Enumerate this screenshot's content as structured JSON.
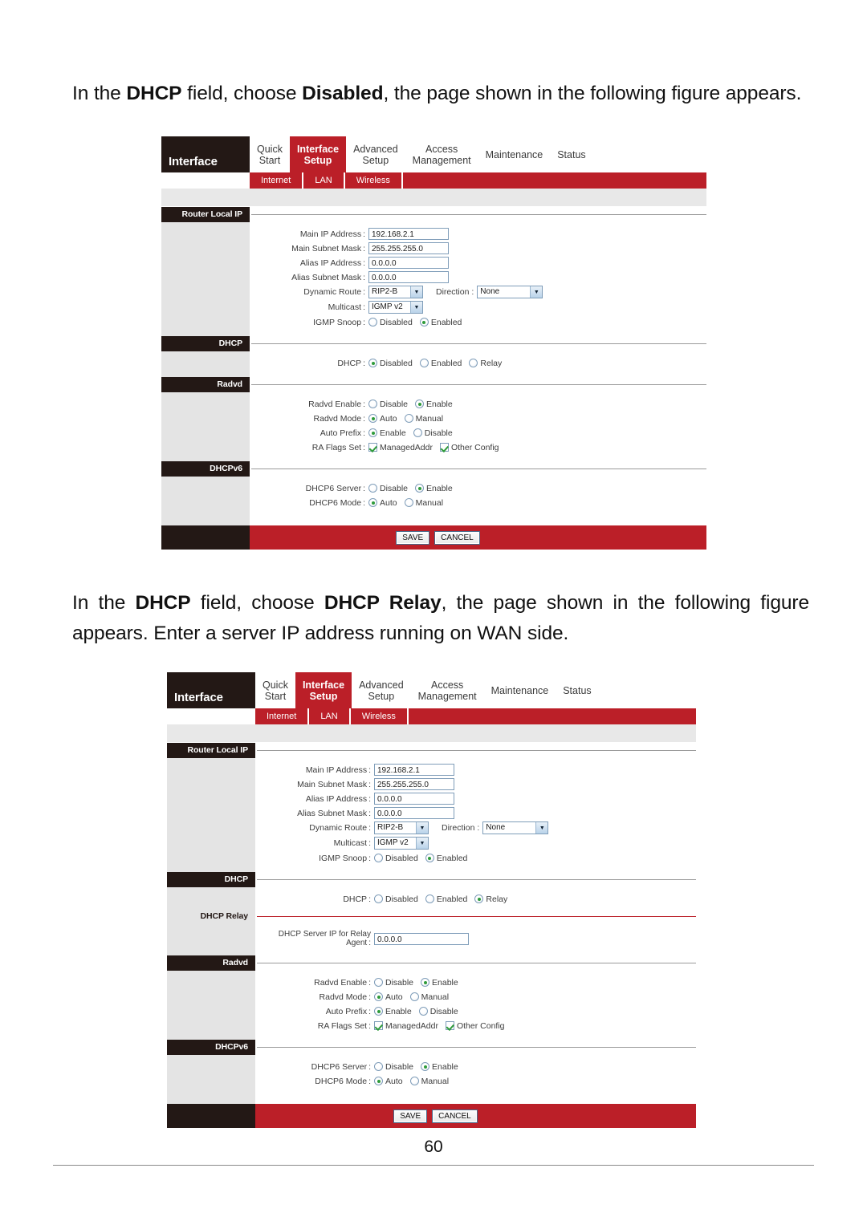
{
  "document": {
    "paragraph_1": {
      "pre": "In the ",
      "bold1": "DHCP",
      "mid": " field, choose ",
      "bold2": "Disabled",
      "post": ", the page shown in the following figure appears."
    },
    "paragraph_2": {
      "pre": "In the ",
      "bold1": "DHCP",
      "mid": " field, choose ",
      "bold2": "DHCP Relay",
      "post": ", the page shown in the following figure appears. Enter a server IP address running on WAN side."
    },
    "page_number": "60"
  },
  "colors": {
    "brand_red": "#bb1f28",
    "dark_bar": "#231815",
    "sidebar_gray": "#e4e4e4",
    "radio_green": "#2e9b3a"
  },
  "router_ui": {
    "brand": "Interface",
    "nav": [
      {
        "line1": "Quick",
        "line2": "Start",
        "active": false
      },
      {
        "line1": "Interface",
        "line2": "Setup",
        "active": true
      },
      {
        "line1": "Advanced",
        "line2": "Setup",
        "active": false
      },
      {
        "line1": "Access",
        "line2": "Management",
        "active": false
      },
      {
        "line1": "Maintenance",
        "line2": "",
        "active": false
      },
      {
        "line1": "Status",
        "line2": "",
        "active": false
      }
    ],
    "subnav": [
      "Internet",
      "LAN",
      "Wireless"
    ],
    "sections": {
      "router_local_ip": "Router Local IP",
      "dhcp": "DHCP",
      "dhcp_relay": "DHCP Relay",
      "radvd": "Radvd",
      "dhcpv6": "DHCPv6"
    },
    "fields": {
      "main_ip_label": "Main IP Address",
      "main_ip_value": "192.168.2.1",
      "main_mask_label": "Main Subnet Mask",
      "main_mask_value": "255.255.255.0",
      "alias_ip_label": "Alias IP Address",
      "alias_ip_value": "0.0.0.0",
      "alias_mask_label": "Alias Subnet Mask",
      "alias_mask_value": "0.0.0.0",
      "dynamic_route_label": "Dynamic Route",
      "dynamic_route_value": "RIP2-B",
      "direction_label": "Direction",
      "direction_value": "None",
      "multicast_label": "Multicast",
      "multicast_value": "IGMP v2",
      "igmp_snoop_label": "IGMP Snoop",
      "igmp_snoop_options": [
        "Disabled",
        "Enabled"
      ],
      "igmp_snoop_selected": "Enabled",
      "dhcp_label": "DHCP",
      "dhcp_options": [
        "Disabled",
        "Enabled",
        "Relay"
      ],
      "dhcp_selected_panel1": "Disabled",
      "dhcp_selected_panel2": "Relay",
      "relay_ip_label_line1": "DHCP Server IP for Relay",
      "relay_ip_label_line2": "Agent",
      "relay_ip_value": "0.0.0.0",
      "radvd_enable_label": "Radvd Enable",
      "radvd_enable_options": [
        "Disable",
        "Enable"
      ],
      "radvd_enable_selected": "Enable",
      "radvd_mode_label": "Radvd Mode",
      "radvd_mode_options": [
        "Auto",
        "Manual"
      ],
      "radvd_mode_selected": "Auto",
      "auto_prefix_label": "Auto Prefix",
      "auto_prefix_options": [
        "Enable",
        "Disable"
      ],
      "auto_prefix_selected": "Enable",
      "ra_flags_label": "RA Flags Set",
      "ra_flags_options": [
        "ManagedAddr",
        "Other Config"
      ],
      "ra_flags_checked": [
        "ManagedAddr",
        "Other Config"
      ],
      "dhcp6_server_label": "DHCP6 Server",
      "dhcp6_server_options": [
        "Disable",
        "Enable"
      ],
      "dhcp6_server_selected": "Enable",
      "dhcp6_mode_label": "DHCP6 Mode",
      "dhcp6_mode_options": [
        "Auto",
        "Manual"
      ],
      "dhcp6_mode_selected": "Auto"
    },
    "buttons": {
      "save": "SAVE",
      "cancel": "CANCEL"
    }
  }
}
